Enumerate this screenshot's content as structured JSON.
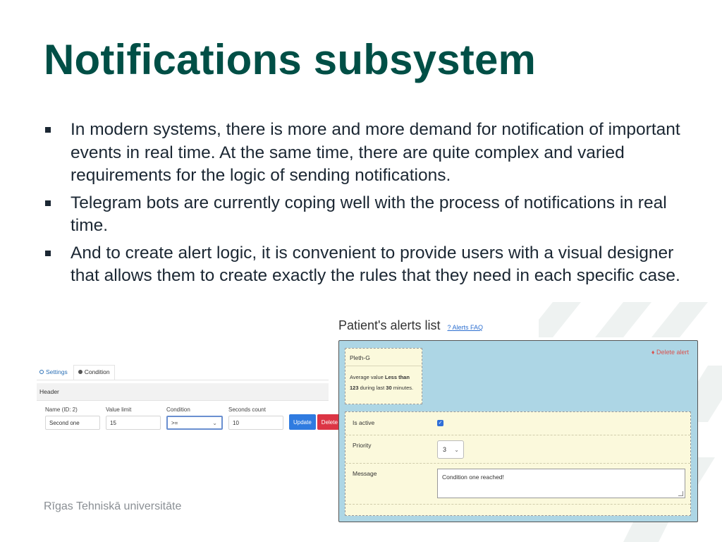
{
  "slide": {
    "title": "Notifications subsystem",
    "bullets": [
      "In modern systems, there is more and more demand for notification of important events in real time. At the same time, there are quite complex and varied requirements for the logic of sending notifications.",
      "Telegram bots are currently coping well with the process of notifications in real time.",
      "And to create alert logic, it is convenient to provide users with a visual designer that allows them to create exactly the rules that they need in each specific case."
    ],
    "footer": "Rīgas Tehniskā universitāte",
    "title_color": "#004f46"
  },
  "settings_form": {
    "tabs": [
      "Settings",
      "Condition"
    ],
    "section_header": "Header",
    "labels": {
      "name": "Name (ID: 2)",
      "value_limit": "Value limit",
      "condition": "Condition",
      "seconds": "Seconds count"
    },
    "values": {
      "name": "Second one",
      "value_limit": "15",
      "condition": ">=",
      "seconds": "10"
    },
    "buttons": {
      "update": "Update",
      "delete": "Delete"
    }
  },
  "alerts": {
    "title": "Patient's alerts list",
    "faq_link": "Alerts FAQ",
    "faq_icon": "?",
    "delete_label": "Delete alert",
    "card": {
      "name": "Pleth-G",
      "desc_prefix": "Average value ",
      "condition": "Less than 123",
      "desc_mid": " during last ",
      "minutes": "30",
      "desc_suffix": " minutes."
    },
    "is_active_label": "Is active",
    "is_active": true,
    "priority_label": "Priority",
    "priority_value": "3",
    "message_label": "Message",
    "message_value": "Condition one reached!",
    "panel_color": "#add6e5",
    "card_color": "#fbf9dc"
  }
}
